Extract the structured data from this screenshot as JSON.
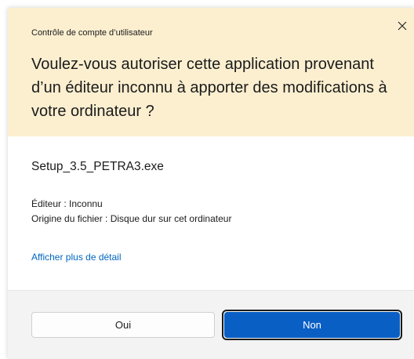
{
  "dialog": {
    "title": "Contrôle de compte d’utilisateur",
    "close_icon": "close-icon",
    "question": "Voulez-vous autoriser cette application provenant d’un éditeur inconnu à apporter des modifications à votre ordinateur ?"
  },
  "details": {
    "filename": "Setup_3.5_PETRA3.exe",
    "publisher": "Éditeur : Inconnu",
    "origin": "Origine du fichier : Disque dur sur cet ordinateur",
    "more_link": "Afficher plus de détail"
  },
  "buttons": {
    "yes_label": "Oui",
    "no_label": "Non"
  },
  "colors": {
    "header_bg": "#fcefd0",
    "link": "#0067c0",
    "primary_button": "#0a5fc4",
    "footer_bg": "#f3f3f3"
  }
}
